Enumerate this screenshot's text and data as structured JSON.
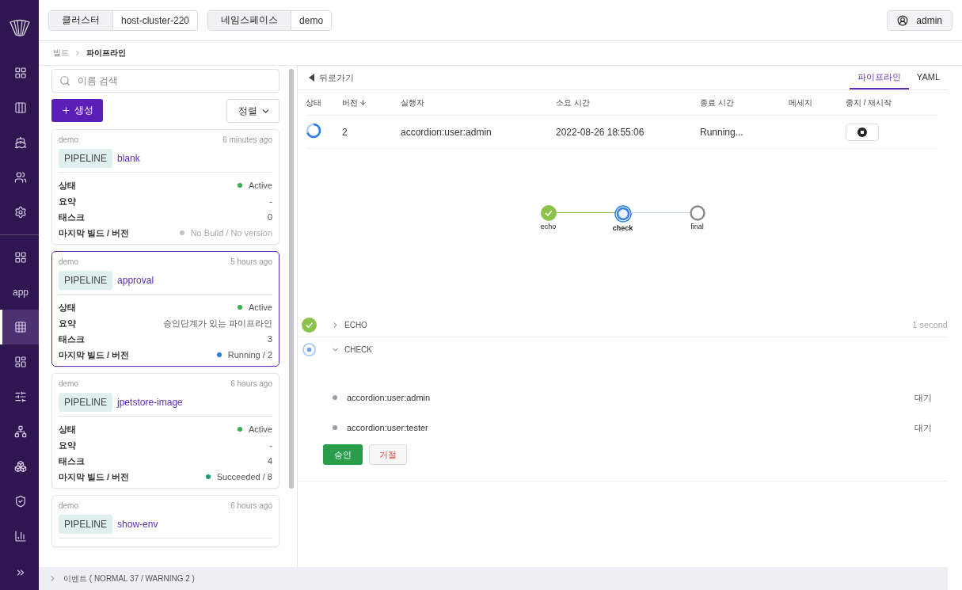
{
  "sidebar": {
    "items": [
      {
        "kind": "icon",
        "selected": false
      },
      {
        "kind": "icon",
        "selected": false
      },
      {
        "kind": "icon",
        "selected": false
      },
      {
        "kind": "icon",
        "selected": false
      },
      {
        "kind": "icon",
        "selected": false
      },
      {
        "kind": "divider"
      },
      {
        "kind": "icon",
        "selected": false
      },
      {
        "kind": "text",
        "label": "app",
        "selected": false
      },
      {
        "kind": "icon",
        "selected": true
      },
      {
        "kind": "icon",
        "selected": false
      },
      {
        "kind": "icon",
        "selected": false
      },
      {
        "kind": "icon",
        "selected": false
      },
      {
        "kind": "icon",
        "selected": false
      },
      {
        "kind": "icon",
        "selected": false
      },
      {
        "kind": "icon",
        "selected": false
      }
    ]
  },
  "topbar": {
    "selectors": [
      {
        "label": "클러스터",
        "value": "host-cluster-220"
      },
      {
        "label": "네임스페이스",
        "value": "demo"
      }
    ],
    "user": "admin"
  },
  "breadcrumb": [
    "빌드",
    "파이프라인"
  ],
  "list": {
    "search": {
      "placeholder": "이름 검색"
    },
    "create_button": "생성",
    "sort_button": "정렬",
    "cards": [
      {
        "namespace": "demo",
        "time": "6 minutes ago",
        "tag": "PIPELINE",
        "name": "blank",
        "selected": false,
        "fields": [
          {
            "label": "상태",
            "value": "Active",
            "color": "#34b04a",
            "muted": false
          },
          {
            "label": "요약",
            "value": "-",
            "muted": false
          },
          {
            "label": "태스크",
            "value": "0",
            "muted": false
          },
          {
            "label": "마지막 빌드 / 버전",
            "value": "No Build / No version",
            "color": "#c4c4c4",
            "muted": true
          }
        ]
      },
      {
        "namespace": "demo",
        "time": "5 hours ago",
        "tag": "PIPELINE",
        "name": "approval",
        "selected": true,
        "fields": [
          {
            "label": "상태",
            "value": "Active",
            "color": "#34b04a",
            "muted": false
          },
          {
            "label": "요약",
            "value": "승인단계가 있는 파이프라인",
            "muted": false
          },
          {
            "label": "태스크",
            "value": "3",
            "muted": false
          },
          {
            "label": "마지막 빌드 / 버전",
            "value": "Running / 2",
            "color": "#2b7de9",
            "muted": false
          }
        ]
      },
      {
        "namespace": "demo",
        "time": "6 hours ago",
        "tag": "PIPELINE",
        "name": "jpetstore-image",
        "selected": false,
        "fields": [
          {
            "label": "상태",
            "value": "Active",
            "color": "#34b04a",
            "muted": false
          },
          {
            "label": "요약",
            "value": "-",
            "muted": false
          },
          {
            "label": "태스크",
            "value": "4",
            "muted": false
          },
          {
            "label": "마지막 빌드 / 버전",
            "value": "Succeeded / 8",
            "color": "#1f9d6b",
            "muted": false
          }
        ]
      },
      {
        "namespace": "demo",
        "time": "6 hours ago",
        "tag": "PIPELINE",
        "name": "show-env",
        "selected": false
      }
    ]
  },
  "detail": {
    "back": "뒤로가기",
    "tabs": [
      {
        "label": "파이프라인",
        "selected": true
      },
      {
        "label": "YAML",
        "selected": false
      }
    ],
    "table": {
      "columns": [
        {
          "label": "상태",
          "sorted": false
        },
        {
          "label": "버전",
          "sorted": true
        },
        {
          "label": "실행자",
          "sorted": false
        },
        {
          "label": "소요 시간",
          "sorted": false
        },
        {
          "label": "종료 시간",
          "sorted": false
        },
        {
          "label": "메세지",
          "sorted": false
        },
        {
          "label": "중지 / 재시작",
          "sorted": false
        }
      ],
      "rows": [
        {
          "kind": "running",
          "version": "2",
          "runner": "accordion:user:admin",
          "duration": "2022-08-26 18:55:06",
          "end": "Running..."
        }
      ]
    },
    "graph": {
      "nodes": [
        {
          "label": "echo",
          "kind": "success"
        },
        {
          "label": "check",
          "kind": "running"
        },
        {
          "label": "final",
          "kind": "pending"
        }
      ]
    },
    "steps": [
      {
        "name": "ECHO",
        "kind": "success",
        "expanded": false,
        "duration": "1 second"
      },
      {
        "name": "CHECK",
        "kind": "running",
        "expanded": true,
        "approvers": [
          {
            "name": "accordion:user:admin",
            "state": "대기"
          },
          {
            "name": "accordion:user:tester",
            "state": "대기"
          }
        ],
        "approve": "승인",
        "reject": "거절"
      }
    ]
  },
  "footer": {
    "label": "이벤트 ( NORMAL 37 / WARNING 2 )"
  }
}
